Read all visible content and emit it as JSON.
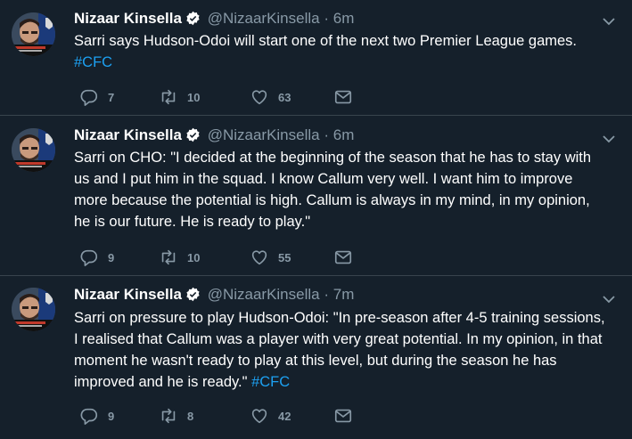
{
  "tweets": [
    {
      "name": "Nizaar Kinsella",
      "handle": "@NizaarKinsella",
      "sep": "·",
      "time": "6m",
      "lines": [
        "Sarri says Hudson-Odoi will start one of the next two Premier League games."
      ],
      "hashtag_line": "#CFC",
      "replies": "7",
      "retweets": "10",
      "likes": "63"
    },
    {
      "name": "Nizaar Kinsella",
      "handle": "@NizaarKinsella",
      "sep": "·",
      "time": "6m",
      "lines": [
        "Sarri on CHO: \"I decided at the beginning of the season that he has to stay with",
        "us and I put him in the squad. I know Callum very well. I want him to improve",
        "more because the potential is high. Callum is always in my mind, in my opinion,",
        "he is our future. He is ready to play.\""
      ],
      "replies": "9",
      "retweets": "10",
      "likes": "55"
    },
    {
      "name": "Nizaar Kinsella",
      "handle": "@NizaarKinsella",
      "sep": "·",
      "time": "7m",
      "lines": [
        "Sarri on pressure to play Hudson-Odoi: \"In pre-season after 4-5 training sessions,",
        "I realised that Callum was a player with very great potential. In my opinion, in that",
        "moment he wasn't ready to play at this level, but during the season he has"
      ],
      "last_line": "improved and he is ready.\" ",
      "last_tag": "#CFC",
      "replies": "9",
      "retweets": "8",
      "likes": "42"
    }
  ],
  "colors": {
    "background": "#15202b",
    "muted": "#8899a6",
    "link": "#1da1f2",
    "divider": "#38444d"
  },
  "icons": [
    "avatar",
    "verified-badge-icon",
    "chevron-down-icon",
    "reply-icon",
    "retweet-icon",
    "like-icon",
    "message-icon"
  ]
}
